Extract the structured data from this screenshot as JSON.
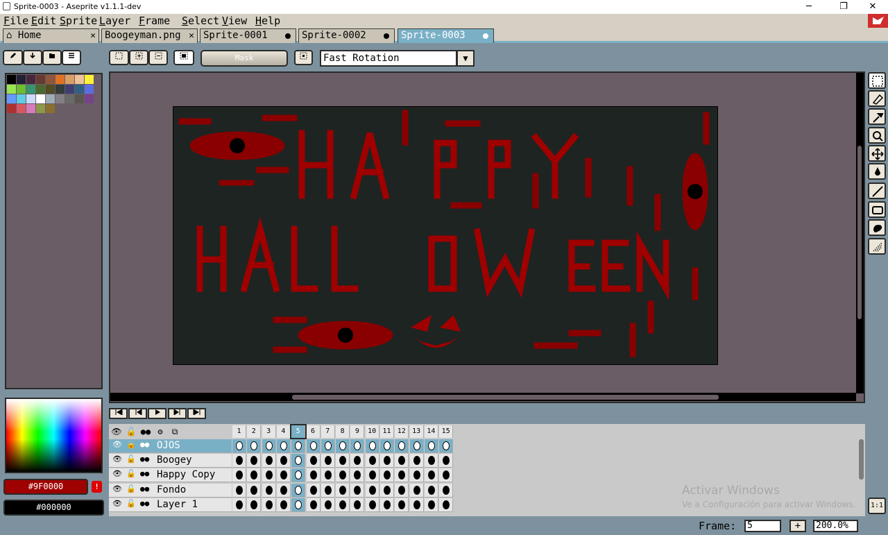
{
  "window": {
    "title": "Sprite-0003 - Aseprite v1.1.1-dev",
    "minimize": "─",
    "maximize": "❐",
    "close": "✕"
  },
  "menu": [
    "File",
    "Edit",
    "Sprite",
    "Layer",
    "Frame",
    "Select",
    "View",
    "Help"
  ],
  "tabs": [
    {
      "label": "Home",
      "state": "close"
    },
    {
      "label": "Boogeyman.png",
      "state": "close"
    },
    {
      "label": "Sprite-0001",
      "state": "modified"
    },
    {
      "label": "Sprite-0002",
      "state": "modified"
    },
    {
      "label": "Sprite-0003",
      "state": "modified-active"
    }
  ],
  "toolbar": {
    "mask_label": "Mask",
    "rotation": "Fast Rotation",
    "dropdown_arrow": "▼"
  },
  "colors": {
    "foreground": "#9F0000",
    "background": "#000000",
    "accent": "#7ab0c6",
    "palette": [
      "#000000",
      "#222034",
      "#45283c",
      "#663931",
      "#8f563b",
      "#df7126",
      "#d9a066",
      "#eec39a",
      "#fbf236",
      "#99e550",
      "#6abe30",
      "#37946e",
      "#4b692f",
      "#524b24",
      "#323c39",
      "#3f3f74",
      "#306082",
      "#5b6ee1",
      "#639bff",
      "#5fcde4",
      "#cbdbfc",
      "#ffffff",
      "#9badb7",
      "#847e87",
      "#696a6a",
      "#595652",
      "#76428a",
      "#ac3232",
      "#d95763",
      "#d77bba",
      "#8f974a",
      "#8a6f30"
    ]
  },
  "warning_mark": "!",
  "layers": [
    {
      "name": "OJOS",
      "selected": true
    },
    {
      "name": "Boogey",
      "selected": false
    },
    {
      "name": "Happy Copy",
      "selected": false
    },
    {
      "name": "Fondo",
      "selected": false
    },
    {
      "name": "Layer 1",
      "selected": false
    }
  ],
  "frames": [
    "1",
    "2",
    "3",
    "4",
    "5",
    "6",
    "7",
    "8",
    "9",
    "10",
    "11",
    "12",
    "13",
    "14",
    "15"
  ],
  "current_frame_index": 5,
  "watermark": {
    "line1": "Activar Windows",
    "line2": "Ve a Configuración para activar Windows."
  },
  "status": {
    "frame_label": "Frame:",
    "frame_value": "5",
    "plus": "+",
    "zoom": "200.0%"
  },
  "tool_one_to_one": "1:1"
}
